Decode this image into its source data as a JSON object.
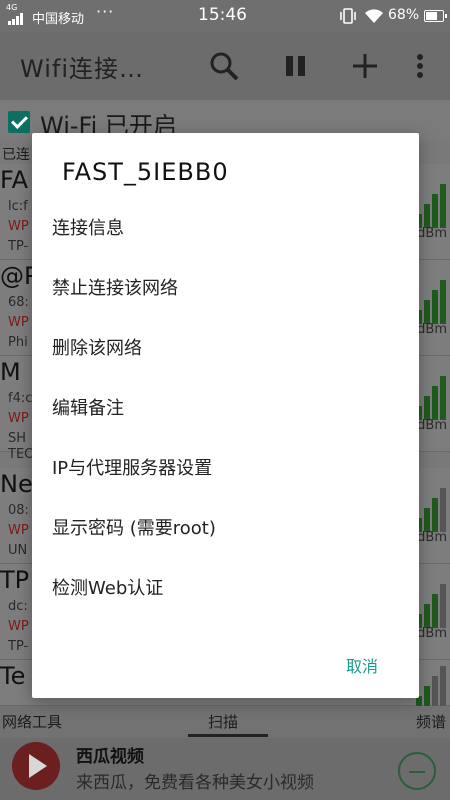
{
  "status_bar": {
    "network_type": "4G",
    "carrier": "中国移动",
    "overflow": "···",
    "time": "15:46",
    "battery": "68%"
  },
  "app_bar": {
    "title": "Wifi连接…",
    "icons": [
      "search-icon",
      "pause-icon",
      "add-icon",
      "more-icon"
    ]
  },
  "background": {
    "wifi_toggle_label": "Wi-Fi 已开启",
    "connected_header": "已连",
    "networks": [
      {
        "ssid": "FA",
        "mac": "lc:f",
        "security": "WP",
        "vendor": "TP-",
        "dbm": "dBm"
      },
      {
        "ssid": "@P",
        "mac": "68:",
        "security": "WP",
        "vendor": "Phi",
        "dbm": "dBm"
      },
      {
        "ssid": "M",
        "mac": "f4:c",
        "security": "WP",
        "vendor": "SH",
        "vendor2": "TEC",
        "dbm": "dBm"
      },
      {
        "ssid": "Ne",
        "mac": "08:",
        "security": "WP",
        "vendor": "UN",
        "dbm": "dBm"
      },
      {
        "ssid": "TP",
        "mac": "dc:",
        "security": "WP",
        "vendor": "TP-",
        "dbm": "dBm"
      },
      {
        "ssid": "Te"
      }
    ]
  },
  "dialog": {
    "title": "FAST_5IEBB0",
    "items": [
      "连接信息",
      "禁止连接该网络",
      "删除该网络",
      "编辑备注",
      "IP与代理服务器设置",
      "显示密码 (需要root)",
      "检测Web认证"
    ],
    "cancel": "取消"
  },
  "tabs": {
    "left": "网络工具",
    "center": "扫描",
    "right": "频谱"
  },
  "ad": {
    "title": "西瓜视频",
    "subtitle": "来西瓜，免费看各种美女小视频"
  },
  "colors": {
    "accent": "#1a9c8a",
    "checkbox": "#0d6e63",
    "signal": "#1f5a1f",
    "security_text": "#7a1a1a"
  }
}
